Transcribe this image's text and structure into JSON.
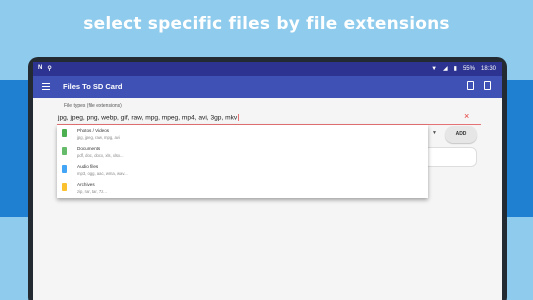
{
  "headline": "select specific files by file extensions",
  "status_bar": {
    "left_icons": [
      "n-logo-icon",
      "usb-icon"
    ],
    "battery": "55%",
    "time": "18:30"
  },
  "app_bar": {
    "title": "Files To SD Card",
    "icons": [
      "menu-icon",
      "copy-icon",
      "document-icon"
    ]
  },
  "field": {
    "label": "File types (file extensions)",
    "value": "jpg, jpeg, png, webp, gif, raw, mpg, mpeg, mp4, avi, 3gp, mkv",
    "clear_icon": "×"
  },
  "add_button": "ADD",
  "dropdown_items": [
    {
      "title": "Photos / Videos",
      "subtitle": "jpg, jpeg, raw, mpg, avi",
      "icon": "photo-icon",
      "color": "#4caf50"
    },
    {
      "title": "Documents",
      "subtitle": "pdf, doc, docx, xls, xlsx...",
      "icon": "document-icon",
      "color": "#66bb6a"
    },
    {
      "title": "Audio files",
      "subtitle": "mp3, ogg, aac, wma, wav...",
      "icon": "music-icon",
      "color": "#42a5f5"
    },
    {
      "title": "Archives",
      "subtitle": "zip, rar, tar, 7z...",
      "icon": "archive-icon",
      "color": "#fbc02d"
    }
  ],
  "colors": {
    "app_bar": "#3f51b5",
    "status_bar": "#2c3390",
    "accent_error": "#e57373",
    "background_light": "#8ecbec",
    "background_band": "#1f7fd1"
  }
}
